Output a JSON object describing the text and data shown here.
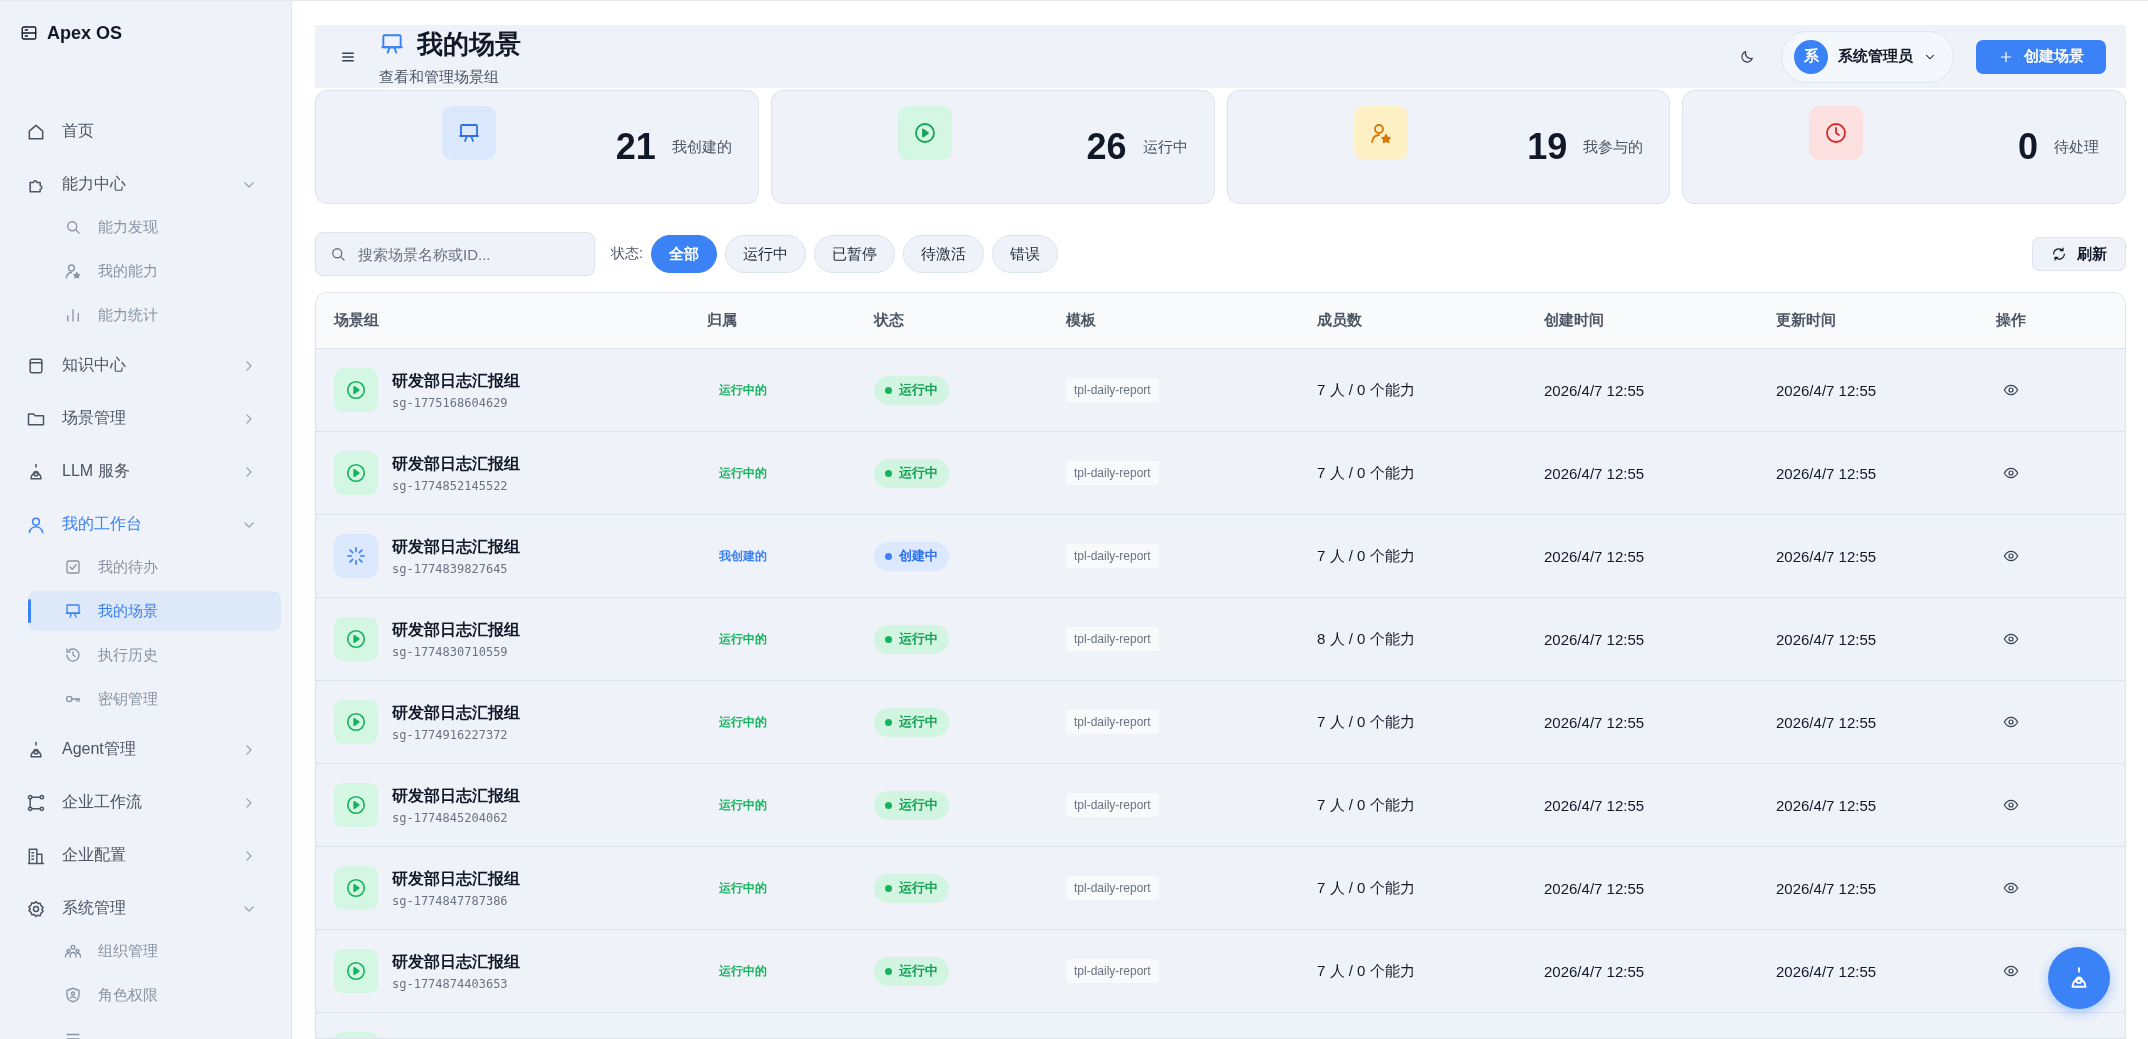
{
  "brand": {
    "name": "Apex OS"
  },
  "sidebar": {
    "items": [
      {
        "label": "首页",
        "kind": "link",
        "active": false
      },
      {
        "label": "能力中心",
        "kind": "group",
        "expanded": true,
        "active": false,
        "children": [
          {
            "label": "能力发现",
            "selected": false
          },
          {
            "label": "我的能力",
            "selected": false
          },
          {
            "label": "能力统计",
            "selected": false
          }
        ]
      },
      {
        "label": "知识中心",
        "kind": "group",
        "expanded": false,
        "active": false
      },
      {
        "label": "场景管理",
        "kind": "group",
        "expanded": false,
        "active": false
      },
      {
        "label": "LLM 服务",
        "kind": "group",
        "expanded": false,
        "active": false
      },
      {
        "label": "我的工作台",
        "kind": "group",
        "expanded": true,
        "active": true,
        "children": [
          {
            "label": "我的待办",
            "selected": false
          },
          {
            "label": "我的场景",
            "selected": true
          },
          {
            "label": "执行历史",
            "selected": false
          },
          {
            "label": "密钥管理",
            "selected": false
          }
        ]
      },
      {
        "label": "Agent管理",
        "kind": "group",
        "expanded": false,
        "active": false
      },
      {
        "label": "企业工作流",
        "kind": "group",
        "expanded": false,
        "active": false
      },
      {
        "label": "企业配置",
        "kind": "group",
        "expanded": false,
        "active": false
      },
      {
        "label": "系统管理",
        "kind": "group",
        "expanded": true,
        "active": false,
        "children": [
          {
            "label": "组织管理",
            "selected": false
          },
          {
            "label": "角色权限",
            "selected": false
          },
          {
            "selected": false
          }
        ]
      }
    ]
  },
  "header": {
    "title": "我的场景",
    "subtitle": "查看和管理场景组",
    "user": {
      "avatar": "系",
      "name": "系统管理员"
    },
    "create_button": "创建场景"
  },
  "stats": [
    {
      "value": "21",
      "label": "我创建的",
      "kind": "created"
    },
    {
      "value": "26",
      "label": "运行中",
      "kind": "running"
    },
    {
      "value": "19",
      "label": "我参与的",
      "kind": "joined"
    },
    {
      "value": "0",
      "label": "待处理",
      "kind": "pending"
    }
  ],
  "filter": {
    "search": {
      "placeholder": "搜索场景名称或ID..."
    },
    "status_label": "状态:",
    "chips": [
      {
        "label": "全部",
        "selected": true
      },
      {
        "label": "运行中",
        "selected": false
      },
      {
        "label": "已暂停",
        "selected": false
      },
      {
        "label": "待激活",
        "selected": false
      },
      {
        "label": "错误",
        "selected": false
      }
    ],
    "refresh_button": "刷新"
  },
  "table": {
    "columns": [
      "场景组",
      "归属",
      "状态",
      "模板",
      "成员数",
      "创建时间",
      "更新时间",
      "操作"
    ],
    "rows": [
      {
        "name": "研发部日志汇报组",
        "id": "sg-1775168604629",
        "owner": "运行中的",
        "status": "运行中",
        "kind": "running",
        "template": "tpl-daily-report",
        "members": "7 人 / 0 个能力",
        "created": "2026/4/7 12:55",
        "updated": "2026/4/7 12:55"
      },
      {
        "name": "研发部日志汇报组",
        "id": "sg-1774852145522",
        "owner": "运行中的",
        "status": "运行中",
        "kind": "running",
        "template": "tpl-daily-report",
        "members": "7 人 / 0 个能力",
        "created": "2026/4/7 12:55",
        "updated": "2026/4/7 12:55"
      },
      {
        "name": "研发部日志汇报组",
        "id": "sg-1774839827645",
        "owner": "我创建的",
        "status": "创建中",
        "kind": "creating",
        "template": "tpl-daily-report",
        "members": "7 人 / 0 个能力",
        "created": "2026/4/7 12:55",
        "updated": "2026/4/7 12:55"
      },
      {
        "name": "研发部日志汇报组",
        "id": "sg-1774830710559",
        "owner": "运行中的",
        "status": "运行中",
        "kind": "running",
        "template": "tpl-daily-report",
        "members": "8 人 / 0 个能力",
        "created": "2026/4/7 12:55",
        "updated": "2026/4/7 12:55"
      },
      {
        "name": "研发部日志汇报组",
        "id": "sg-1774916227372",
        "owner": "运行中的",
        "status": "运行中",
        "kind": "running",
        "template": "tpl-daily-report",
        "members": "7 人 / 0 个能力",
        "created": "2026/4/7 12:55",
        "updated": "2026/4/7 12:55"
      },
      {
        "name": "研发部日志汇报组",
        "id": "sg-1774845204062",
        "owner": "运行中的",
        "status": "运行中",
        "kind": "running",
        "template": "tpl-daily-report",
        "members": "7 人 / 0 个能力",
        "created": "2026/4/7 12:55",
        "updated": "2026/4/7 12:55"
      },
      {
        "name": "研发部日志汇报组",
        "id": "sg-1774847787386",
        "owner": "运行中的",
        "status": "运行中",
        "kind": "running",
        "template": "tpl-daily-report",
        "members": "7 人 / 0 个能力",
        "created": "2026/4/7 12:55",
        "updated": "2026/4/7 12:55"
      },
      {
        "name": "研发部日志汇报组",
        "id": "sg-1774874403653",
        "owner": "运行中的",
        "status": "运行中",
        "kind": "running",
        "template": "tpl-daily-report",
        "members": "7 人 / 0 个能力",
        "created": "2026/4/7 12:55",
        "updated": "2026/4/7 12:55"
      },
      {
        "kind": "running"
      }
    ]
  }
}
